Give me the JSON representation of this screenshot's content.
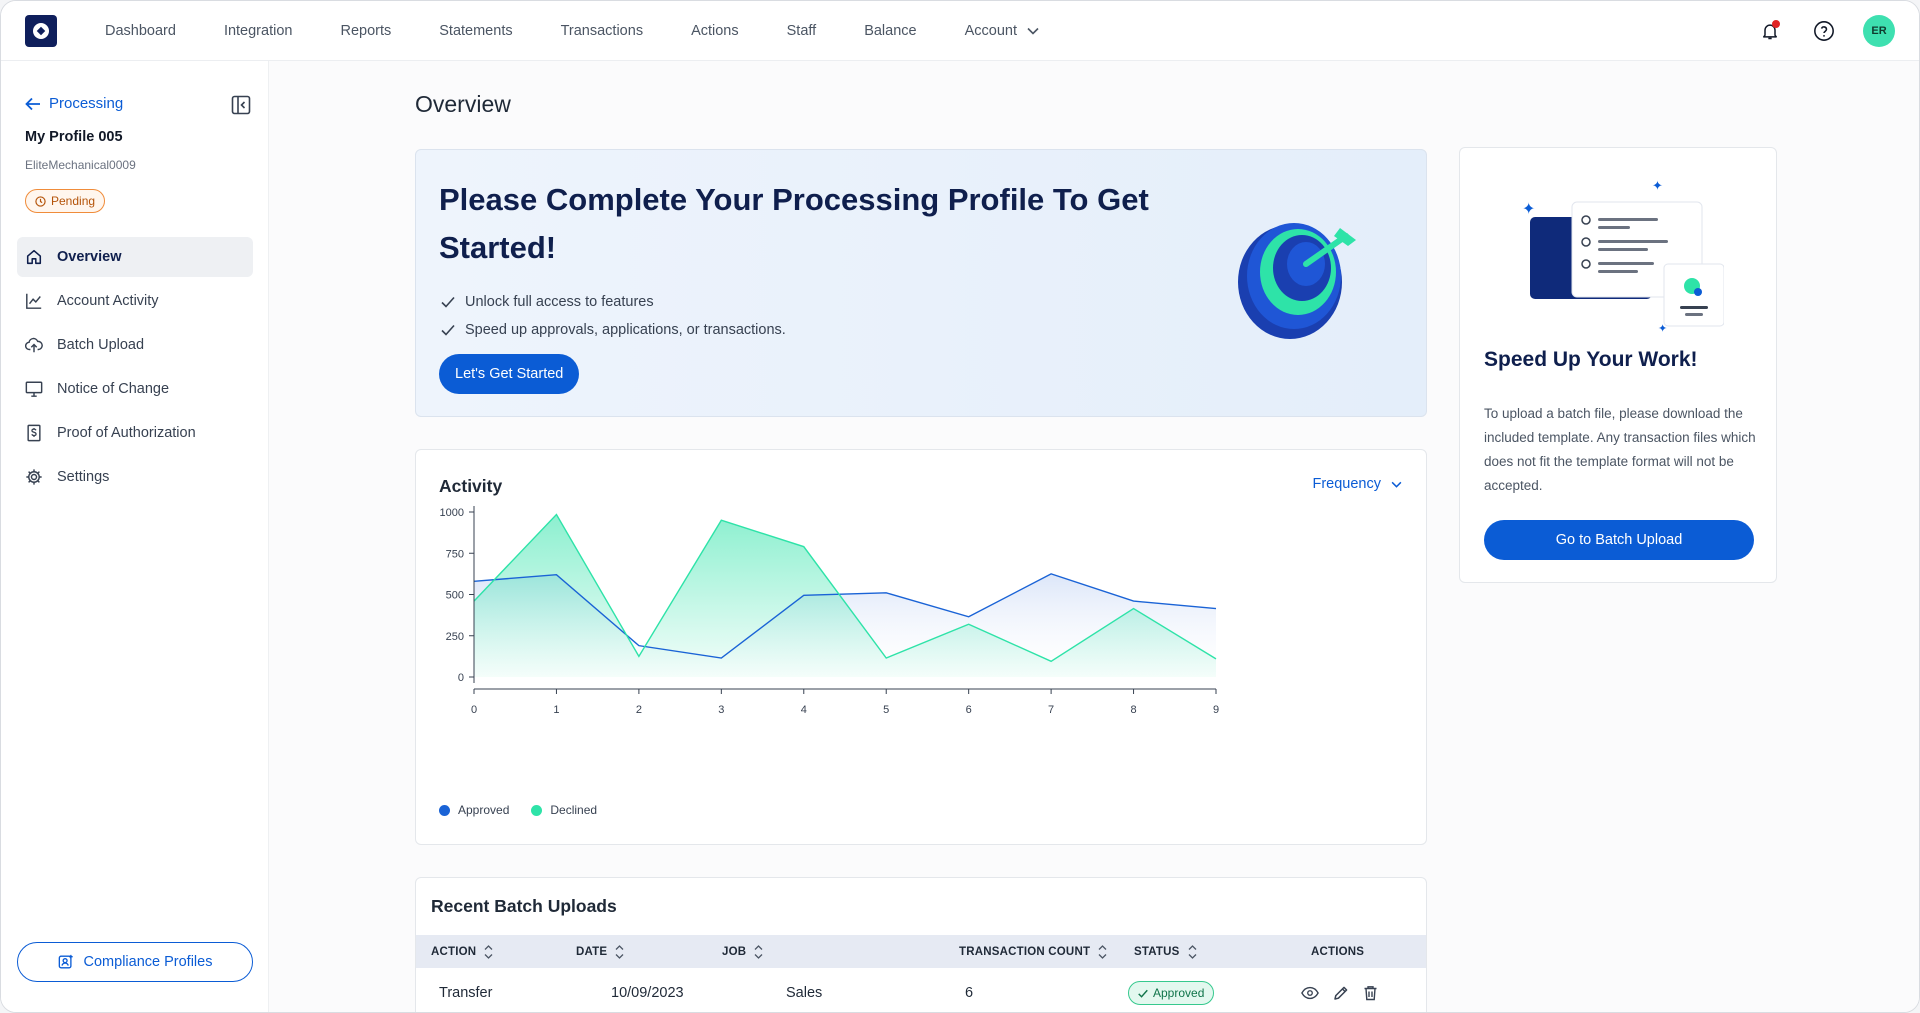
{
  "nav": {
    "links": [
      "Dashboard",
      "Integration",
      "Reports",
      "Statements",
      "Transactions",
      "Actions",
      "Staff",
      "Balance"
    ],
    "account_label": "Account",
    "avatar_initials": "ER"
  },
  "sidebar": {
    "back_label": "Processing",
    "profile_name": "My Profile 005",
    "profile_sub": "EliteMechanical0009",
    "status_badge": "Pending",
    "items": [
      {
        "label": "Overview",
        "icon": "home-icon",
        "active": true
      },
      {
        "label": "Account Activity",
        "icon": "chart-line-icon",
        "active": false
      },
      {
        "label": "Batch Upload",
        "icon": "upload-cloud-icon",
        "active": false
      },
      {
        "label": "Notice of Change",
        "icon": "monitor-icon",
        "active": false
      },
      {
        "label": "Proof of Authorization",
        "icon": "dollar-file-icon",
        "active": false
      },
      {
        "label": "Settings",
        "icon": "gear-icon",
        "active": false
      }
    ],
    "compliance_button": "Compliance Profiles"
  },
  "main": {
    "page_title": "Overview",
    "hero": {
      "title": "Please  Complete Your Processing Profile To Get Started!",
      "checks": [
        "Unlock full access to features",
        "Speed up approvals, applications, or transactions."
      ],
      "button": "Let's Get Started"
    },
    "side_card": {
      "title": "Speed Up Your Work!",
      "text": "To upload a batch file, please download the included template. Any transaction files which does not fit the template format will not be accepted.",
      "button": "Go to Batch Upload"
    },
    "activity": {
      "title": "Activity",
      "filter_label": "Frequency"
    },
    "batch": {
      "title": "Recent Batch Uploads",
      "columns": [
        "ACTION",
        "DATE",
        "JOB",
        "TRANSACTION COUNT",
        "STATUS",
        "ACTIONS"
      ],
      "rows": [
        {
          "action": "Transfer",
          "date": "10/09/2023",
          "job": "Sales",
          "count": "6",
          "status": "Approved"
        }
      ]
    }
  },
  "colors": {
    "primary": "#0b5cd5",
    "approved_line": "#1a63d6",
    "declined_line": "#2ee3a8",
    "navy": "#0f1f4d"
  },
  "chart_data": {
    "type": "area",
    "x": [
      0,
      1,
      2,
      3,
      4,
      5,
      6,
      7,
      8,
      9
    ],
    "ylim": [
      0,
      1000
    ],
    "yticks": [
      0,
      250,
      500,
      750,
      1000
    ],
    "series": [
      {
        "name": "Approved",
        "color": "#1a63d6",
        "values": [
          580,
          620,
          190,
          115,
          495,
          510,
          365,
          625,
          460,
          415
        ]
      },
      {
        "name": "Declined",
        "color": "#2ee3a8",
        "values": [
          460,
          985,
          125,
          950,
          790,
          115,
          320,
          95,
          415,
          110
        ]
      }
    ],
    "legend_position": "bottom-left",
    "grid": false
  }
}
